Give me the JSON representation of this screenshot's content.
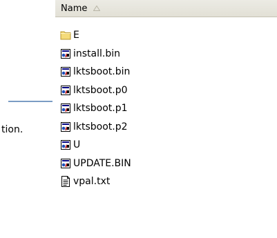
{
  "left_pane": {
    "text": "tion."
  },
  "header": {
    "name_label": "Name",
    "sort_icon": "sort-ascending-arrow-icon"
  },
  "files": [
    {
      "name": "E",
      "icon": "folder-icon"
    },
    {
      "name": "install.bin",
      "icon": "bin-file-icon"
    },
    {
      "name": "lktsboot.bin",
      "icon": "bin-file-icon"
    },
    {
      "name": "lktsboot.p0",
      "icon": "bin-file-icon"
    },
    {
      "name": "lktsboot.p1",
      "icon": "bin-file-icon"
    },
    {
      "name": "lktsboot.p2",
      "icon": "bin-file-icon"
    },
    {
      "name": "U",
      "icon": "bin-file-icon"
    },
    {
      "name": "UPDATE.BIN",
      "icon": "bin-file-icon"
    },
    {
      "name": "vpal.txt",
      "icon": "text-file-icon"
    }
  ],
  "colors": {
    "folder_fill": "#f5db7a",
    "header_bg": "#ecebe4",
    "divider": "#7a9cc4"
  }
}
